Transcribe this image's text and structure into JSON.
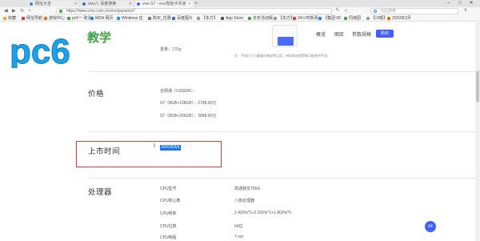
{
  "browser": {
    "tabs": [
      {
        "title": "网址大全",
        "active": false
      },
      {
        "title": "vivo八 百度搜索",
        "active": false
      },
      {
        "title": "vivo S7 - vivo智能手机官",
        "active": true
      }
    ],
    "url": "https://www.vivo.com.cn/vivo/param/s7",
    "search_placeholder": "点此搜索",
    "bookmarks": [
      "收藏",
      "网址导航",
      "游戏中心",
      "pc6一 取消",
      "MSN 网页",
      "Windows 应",
      "购买_优惠",
      "百度图片",
      "【东方】",
      "App Store",
      "去年活动版",
      "【东方】",
      "24小时新闻",
      "【集团 06",
      "同城团",
      "【冷眼】",
      "2020年2月"
    ]
  },
  "site": {
    "logo_letters": "pc6",
    "logo_badge": "教学",
    "nav": [
      "概览",
      "图库",
      "参数规格"
    ],
    "buy_label": "购买"
  },
  "specs": {
    "weight": "重量：170g",
    "note": "注：手机尺寸与重量仅做说明之用，材料和流程等都可能有所不同。",
    "price": {
      "title": "价格",
      "rows": [
        "全网通（V2020A）：",
        "S7（8GB+128GB）：2798.00元",
        "S7（8GB+256GB）：3098.00元"
      ]
    },
    "launch": {
      "title": "上市时间",
      "value": "2020年8月"
    },
    "processor": {
      "title": "处理器",
      "rows": [
        {
          "label": "CPU型号",
          "value": "高通骁龙765G"
        },
        {
          "label": "CPU核心数",
          "value": "八核处理器"
        },
        {
          "label": "CPU频率",
          "value": "2.4GHz*1+2.2GHz*1+1.8GHz*6"
        },
        {
          "label": "CPU位数",
          "value": "64位"
        },
        {
          "label": "CPU制程",
          "value": "7 nm"
        }
      ]
    }
  },
  "float_button": "64"
}
